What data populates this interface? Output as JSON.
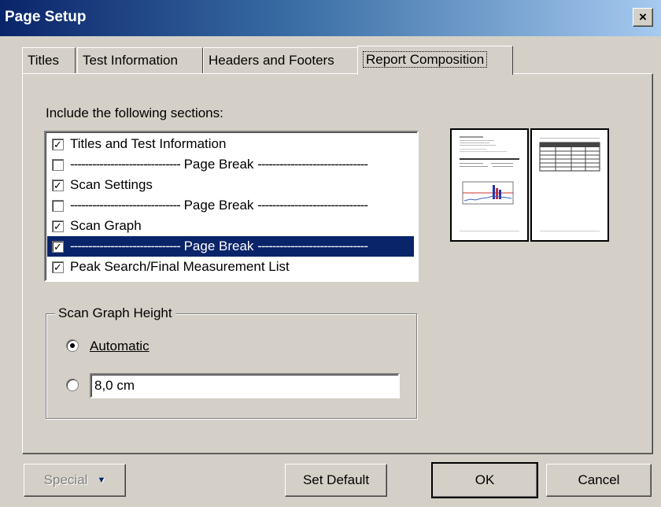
{
  "window": {
    "title": "Page Setup",
    "close_label": "×"
  },
  "tabs": [
    {
      "label": "Titles",
      "accel": "T"
    },
    {
      "label": "Test Information",
      "accel": "I"
    },
    {
      "label": "Headers and Footers",
      "accel": "H"
    },
    {
      "label": "Report Composition",
      "accel": "C",
      "active": true
    }
  ],
  "sections": {
    "label": "Include the following sections:",
    "items": [
      {
        "label": "Titles and Test Information",
        "checked": true,
        "selected": false
      },
      {
        "label": "Page Break",
        "checked": false,
        "selected": false
      },
      {
        "label": "Scan Settings",
        "checked": true,
        "selected": false
      },
      {
        "label": "Page Break",
        "checked": false,
        "selected": false
      },
      {
        "label": "Scan Graph",
        "checked": true,
        "selected": false
      },
      {
        "label": "Page Break",
        "checked": true,
        "selected": true
      },
      {
        "label": "Peak Search/Final Measurement List",
        "checked": true,
        "selected": false
      }
    ]
  },
  "scan_graph_height": {
    "title": "Scan Graph Height",
    "automatic_label": "Automatic",
    "automatic_selected": true,
    "custom_value": "8,0 cm"
  },
  "buttons": {
    "special": "Special",
    "set_default": "Set Default",
    "ok": "OK",
    "cancel": "Cancel"
  },
  "colors": {
    "selection": "#0a246a",
    "titlebar_start": "#0a246a",
    "face": "#d4d0c8"
  }
}
